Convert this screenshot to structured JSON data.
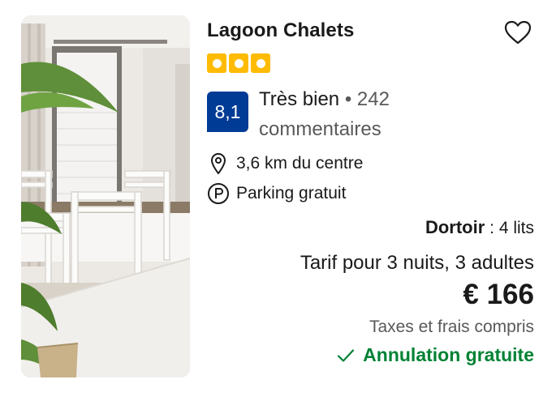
{
  "property": {
    "name": "Lagoon Chalets",
    "stars": 3,
    "favorite_icon": "heart-outline-icon"
  },
  "rating": {
    "score": "8,1",
    "label": "Très bien",
    "separator": "•",
    "count": "242",
    "count_label": "commentaires"
  },
  "location": {
    "icon": "map-pin-icon",
    "distance": "3,6 km du centre"
  },
  "amenities": {
    "icon": "parking-icon",
    "parking": "Parking gratuit"
  },
  "room": {
    "type": "Dortoir",
    "separator": " : ",
    "beds": "4 lits"
  },
  "pricing": {
    "label": "Tarif pour 3 nuits, 3 adultes",
    "price": "€ 166",
    "taxes_note": "Taxes et frais compris"
  },
  "cancellation": {
    "icon": "check-icon",
    "text": "Annulation gratuite"
  },
  "colors": {
    "star": "#febb02",
    "score_badge": "#003b95",
    "free_cancellation": "#008234",
    "muted_text": "#595959"
  }
}
